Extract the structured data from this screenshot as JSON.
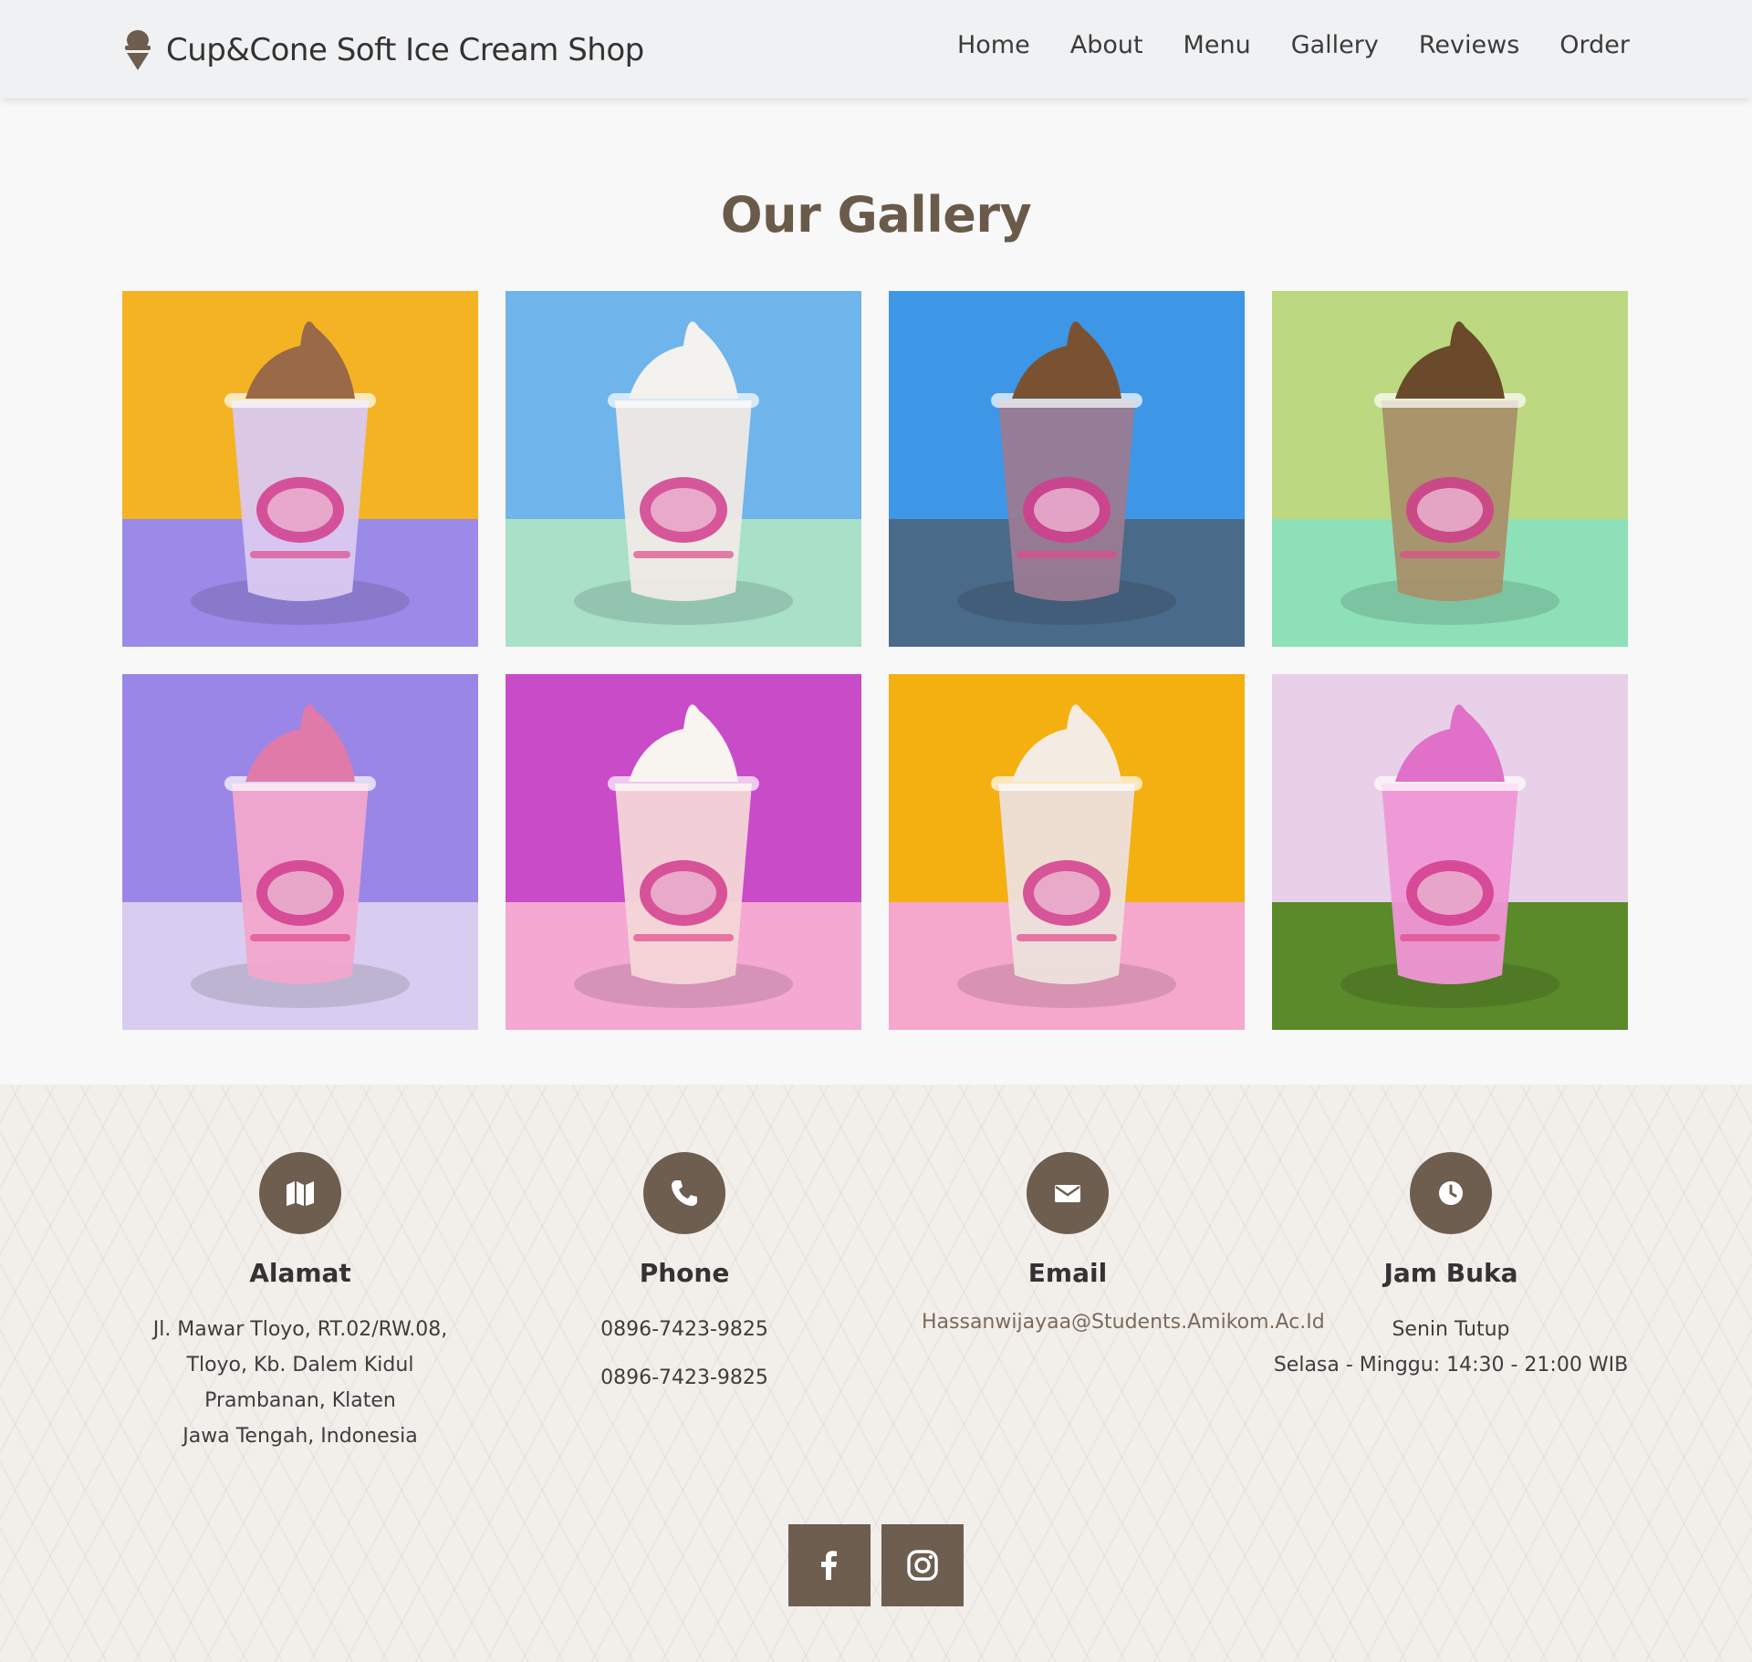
{
  "brand": {
    "name": "Cup&Cone Soft Ice Cream Shop",
    "icon": "ice-cream-cone-icon"
  },
  "nav": [
    {
      "label": "Home"
    },
    {
      "label": "About"
    },
    {
      "label": "Menu"
    },
    {
      "label": "Gallery"
    },
    {
      "label": "Reviews"
    },
    {
      "label": "Order"
    }
  ],
  "gallery": {
    "title": "Our Gallery",
    "images": [
      {
        "bg": "#f4b323",
        "floor": "#9c8ae8",
        "cream": "#9a6a48",
        "cup": "#d9c9f0"
      },
      {
        "bg": "#6fb4ea",
        "floor": "#a8e0c8",
        "cream": "#f4f2ee",
        "cup": "#eeeae6"
      },
      {
        "bg": "#3e96e6",
        "floor": "#4a6a8a",
        "cream": "#7a5232",
        "cup": "#9a7a92"
      },
      {
        "bg": "#bcd880",
        "floor": "#8ee0b8",
        "cream": "#6a4a2a",
        "cup": "#a8906a"
      },
      {
        "bg": "#9a86e6",
        "floor": "#d8cdf0",
        "cream": "#e07aa8",
        "cup": "#f2a6cc"
      },
      {
        "bg": "#c84cc8",
        "floor": "#f4a8d2",
        "cream": "#f8f4f0",
        "cup": "#f4d6d8"
      },
      {
        "bg": "#f4b010",
        "floor": "#f6a8cc",
        "cream": "#f4ece2",
        "cup": "#ece0dc"
      },
      {
        "bg": "#e8d0e8",
        "floor": "#5a8a2a",
        "cream": "#e070c8",
        "cup": "#f096d6"
      }
    ]
  },
  "footer": {
    "address": {
      "icon": "map-icon",
      "title": "Alamat",
      "lines": [
        "Jl. Mawar Tloyo, RT.02/RW.08,",
        "Tloyo, Kb. Dalem Kidul",
        "Prambanan, Klaten",
        "Jawa Tengah, Indonesia"
      ]
    },
    "phone": {
      "icon": "phone-icon",
      "title": "Phone",
      "lines": [
        "0896-7423-9825",
        "0896-7423-9825"
      ]
    },
    "email": {
      "icon": "envelope-icon",
      "title": "Email",
      "address": "Hassanwijayaa@Students.Amikom.Ac.Id"
    },
    "hours": {
      "icon": "clock-icon",
      "title": "Jam Buka",
      "lines": [
        "Senin Tutup",
        "Selasa - Minggu: 14:30 - 21:00 WIB"
      ]
    },
    "social": [
      {
        "icon": "facebook-icon"
      },
      {
        "icon": "instagram-icon"
      }
    ]
  },
  "colors": {
    "accent": "#6e5e4f",
    "title": "#6a5a4a",
    "nav_bg": "#f0f1f3",
    "footer_bg": "#f2efeb"
  }
}
